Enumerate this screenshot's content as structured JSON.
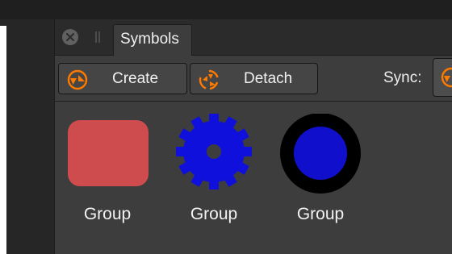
{
  "panel": {
    "tab_title": "Symbols"
  },
  "toolbar": {
    "create_label": "Create",
    "detach_label": "Detach",
    "sync_label": "Sync:"
  },
  "icons": {
    "close": "close-icon",
    "grip": "grip-handle-icon",
    "create": "create-symbol-icon",
    "detach": "detach-symbol-icon",
    "sync": "sync-symbol-icon"
  },
  "symbols": [
    {
      "label": "Group",
      "shape": "rounded-square",
      "color": "#cf4c4e"
    },
    {
      "label": "Group",
      "shape": "gear",
      "color": "#1010dd"
    },
    {
      "label": "Group",
      "shape": "ring",
      "color": "#1010cc"
    }
  ],
  "colors": {
    "accent": "#ff7a00",
    "panel_bg": "#3d3d3d"
  }
}
